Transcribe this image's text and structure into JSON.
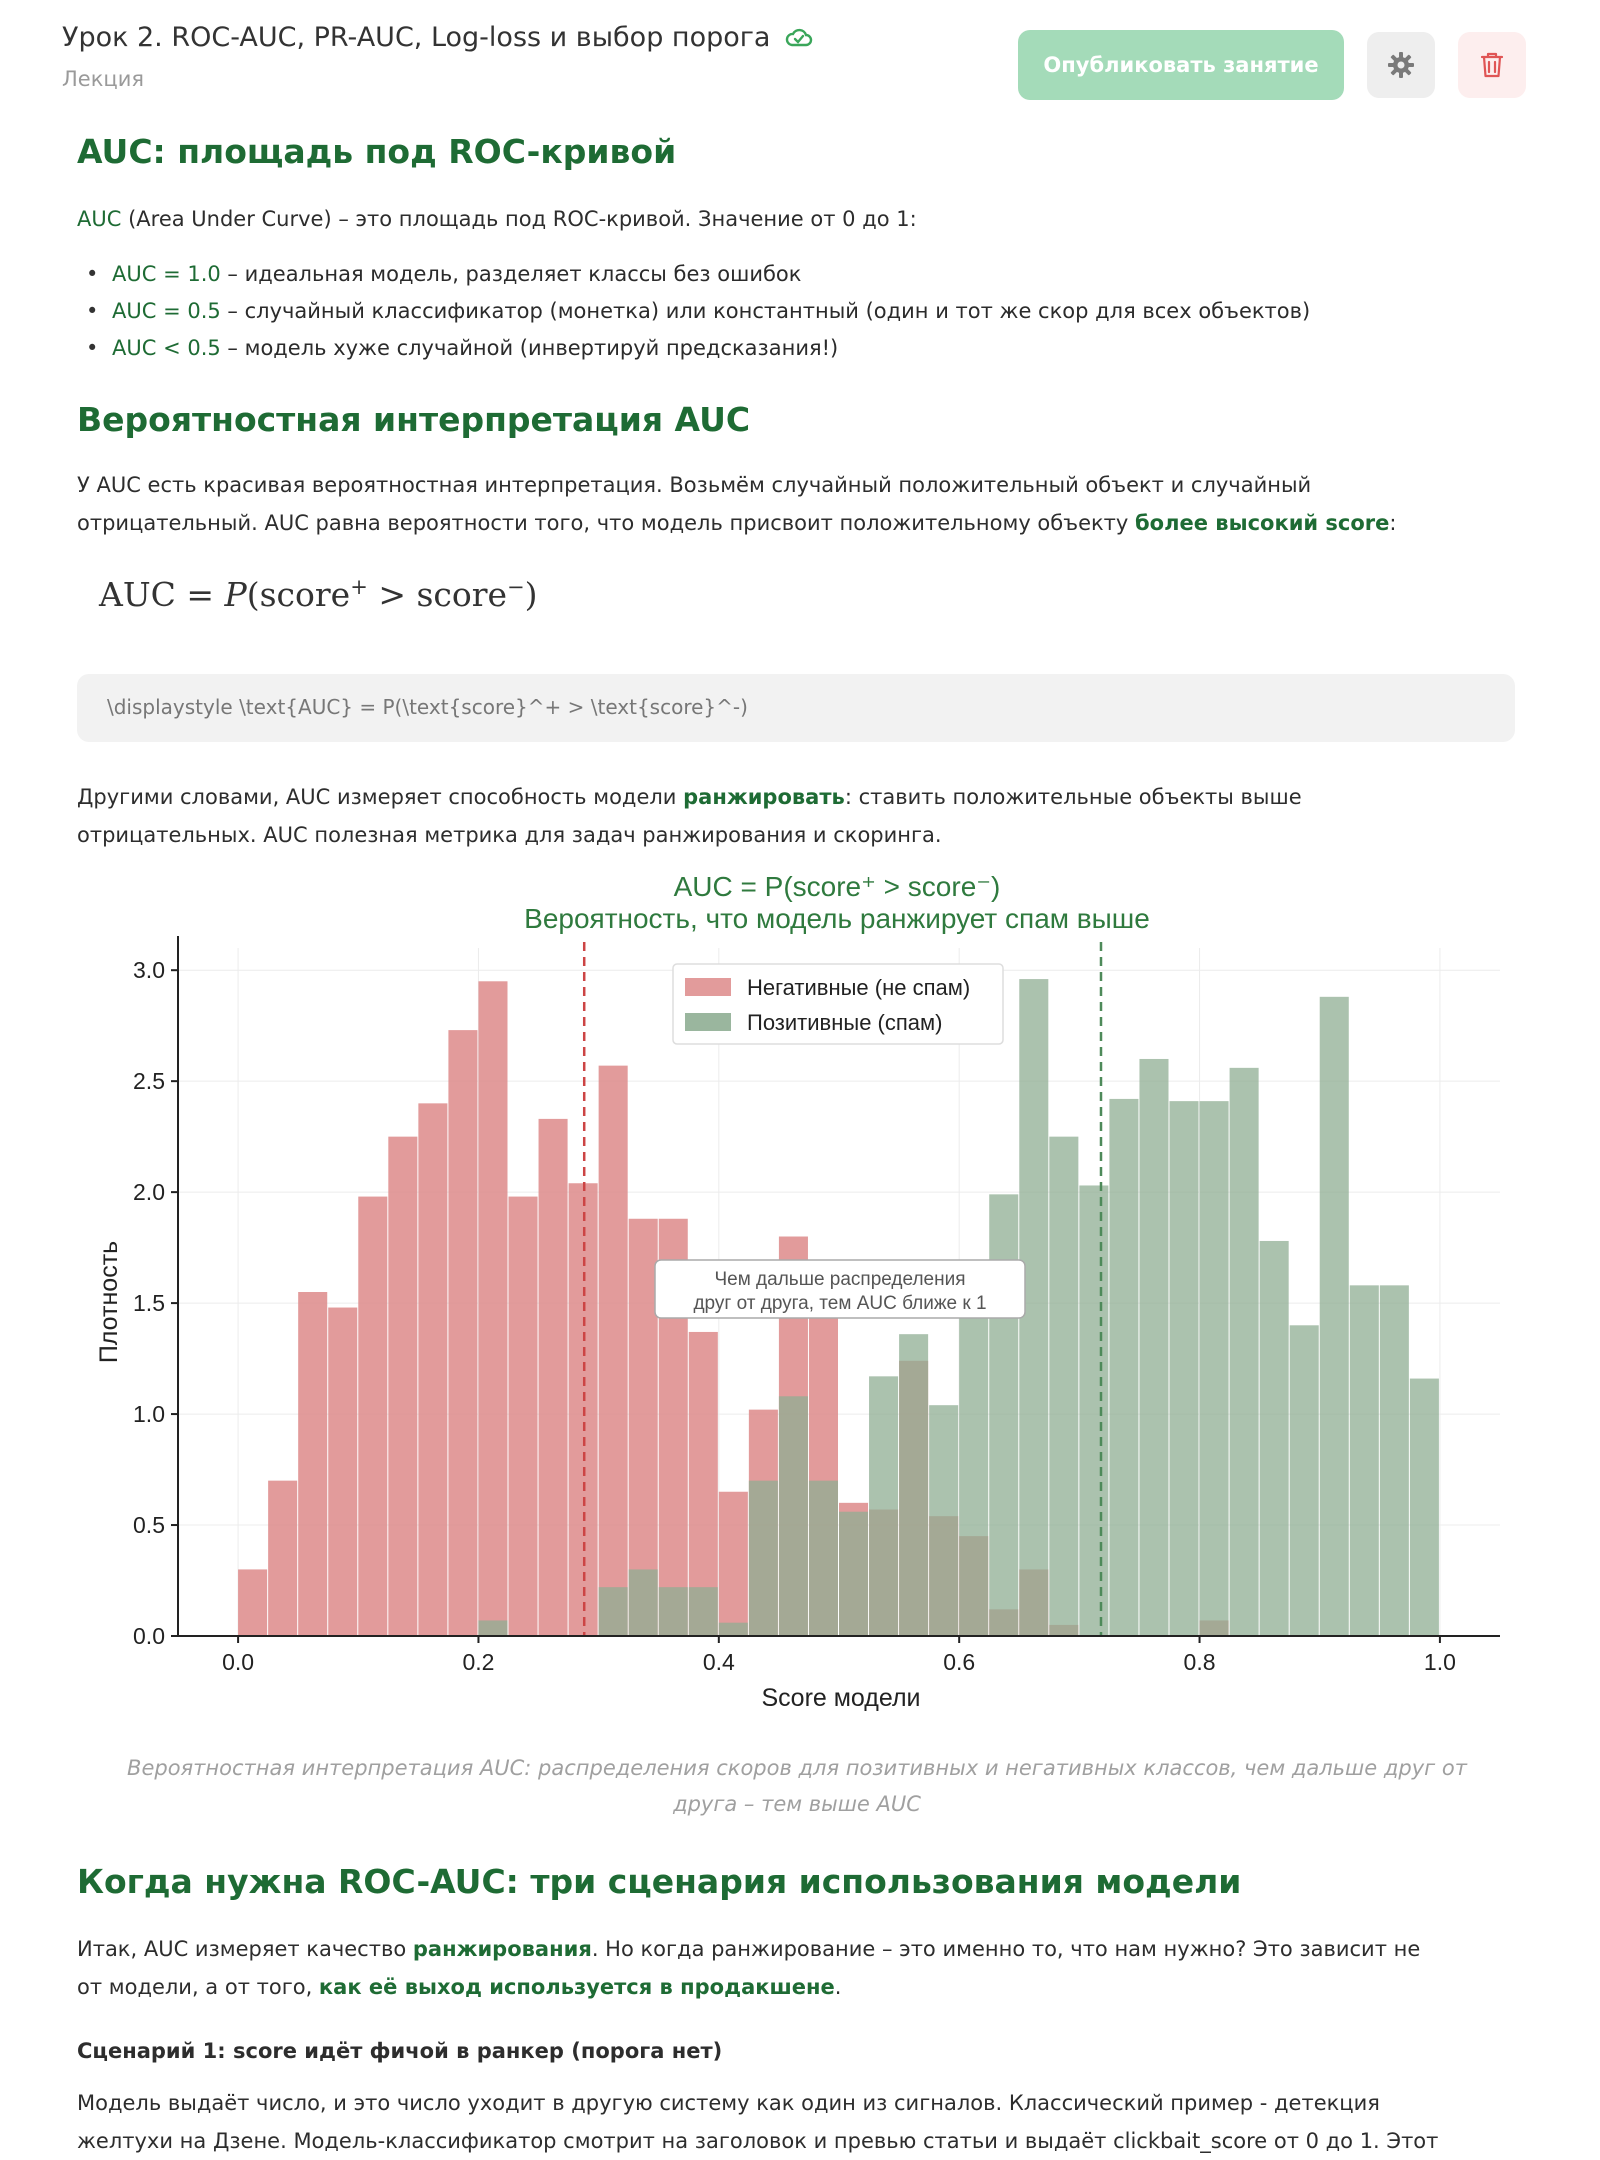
{
  "header": {
    "title": "Урок 2. ROC-AUC, PR-AUC, Log-loss и выбор порога",
    "subtitle": "Лекция",
    "publish_label": "Опубликовать занятие",
    "icons": [
      "cloud-check-icon",
      "gear-icon",
      "trash-icon"
    ]
  },
  "section1": {
    "heading": "AUC: площадь под ROC-кривой",
    "intro_term": "AUC",
    "intro_rest": " (Area Under Curve) – это площадь под ROC-кривой. Значение от 0 до 1:",
    "bullets": [
      {
        "term": "AUC = 1.0",
        "text": " – идеальная модель, разделяет классы без ошибок"
      },
      {
        "term": "AUC = 0.5",
        "text": " – случайный классификатор (монетка) или константный (один и тот же скор для всех объектов)"
      },
      {
        "term": "AUC < 0.5",
        "text": " – модель хуже случайной (инвертируй предсказания!)"
      }
    ]
  },
  "section2": {
    "heading": "Вероятностная интерпретация AUC",
    "para1_part1": "У AUC есть красивая вероятностная интерпретация. Возьмём случайный положительный объект и случайный",
    "para1_part2": "отрицательный. AUC равна вероятности того, что модель присвоит положительному объекту ",
    "para1_highlight": "более высокий score",
    "para1_end": ":",
    "formula_lhs": "AUC = ",
    "formula_p": "P",
    "formula_open": "(score",
    "formula_sup_plus": "+",
    "formula_mid": " > score",
    "formula_sup_minus": "−",
    "formula_close": ")",
    "latex": "\\displaystyle \\text{AUC} = P(\\text{score}^+ > \\text{score}^-)",
    "para2_part1": "Другими словами, AUC измеряет способность модели ",
    "para2_highlight": "ранжировать",
    "para2_part2": ": ставить положительные объекты выше",
    "para2_line2": "отрицательных. AUC полезная метрика для задач ранжирования и скоринга."
  },
  "chart_data": {
    "type": "bar",
    "title": "AUC = P(score⁺ > score⁻)",
    "subtitle": "Вероятность, что модель ранжирует спам выше",
    "xlabel": "Score модели",
    "ylabel": "Плотность",
    "xlim": [
      -0.05,
      1.05
    ],
    "ylim": [
      0,
      3.1
    ],
    "xticks": [
      "0.0",
      "0.2",
      "0.4",
      "0.6",
      "0.8",
      "1.0"
    ],
    "yticks": [
      "0.0",
      "0.5",
      "1.0",
      "1.5",
      "2.0",
      "2.5",
      "3.0"
    ],
    "bin_width": 0.025,
    "bin_starts": [
      0.0,
      0.025,
      0.05,
      0.075,
      0.1,
      0.125,
      0.15,
      0.175,
      0.2,
      0.225,
      0.25,
      0.275,
      0.3,
      0.325,
      0.35,
      0.375,
      0.4,
      0.425,
      0.45,
      0.475,
      0.5,
      0.525,
      0.55,
      0.575,
      0.6,
      0.625,
      0.65,
      0.675,
      0.7,
      0.725,
      0.75,
      0.775,
      0.8,
      0.825,
      0.85,
      0.875,
      0.9,
      0.925,
      0.95,
      0.975
    ],
    "series": [
      {
        "name": "Негативные (не спам)",
        "color": "#dd8a8a",
        "values": [
          0.3,
          0.7,
          1.55,
          1.48,
          1.98,
          2.25,
          2.4,
          2.73,
          2.95,
          1.98,
          2.33,
          2.04,
          2.57,
          1.88,
          1.88,
          1.37,
          0.65,
          1.02,
          1.8,
          1.62,
          0.6,
          0.57,
          1.24,
          0.54,
          0.45,
          0.12,
          0.3,
          0.05,
          0,
          0,
          0,
          0,
          0.07,
          0,
          0,
          0,
          0,
          0,
          0,
          0
        ]
      },
      {
        "name": "Позитивные (спам)",
        "color": "#8fae93",
        "values": [
          0,
          0,
          0,
          0,
          0,
          0,
          0,
          0,
          0.07,
          0,
          0,
          0,
          0.22,
          0.3,
          0.22,
          0.22,
          0.06,
          0.7,
          1.08,
          0.7,
          0.56,
          1.17,
          1.36,
          1.04,
          1.48,
          1.99,
          2.96,
          2.25,
          2.03,
          2.42,
          2.6,
          2.41,
          2.41,
          2.56,
          1.78,
          1.4,
          2.88,
          1.58,
          1.58,
          1.16
        ]
      }
    ],
    "vlines": [
      {
        "x": 0.288,
        "color": "#cc4444",
        "style": "dashed"
      },
      {
        "x": 0.718,
        "color": "#4e8a5a",
        "style": "dashed"
      }
    ],
    "annotation": {
      "line1": "Чем дальше распределения",
      "line2": "друг от друга, тем AUC ближе к 1"
    },
    "legend_position": "top-center",
    "grid": true
  },
  "caption": {
    "line1": "Вероятностная интерпретация AUC: распределения скоров для позитивных и негативных классов, чем дальше друг от",
    "line2": "друга – тем выше AUC"
  },
  "section3": {
    "heading": "Когда нужна ROC-AUC: три сценария использования модели",
    "p1_part1": "Итак, AUC измеряет качество ",
    "p1_highlight1": "ранжирования",
    "p1_part2": ". Но когда ранжирование – это именно то, что нам нужно? Это зависит не",
    "p1_line2_part1": "от модели, а от того, ",
    "p1_highlight2": "как её выход используется в продакшене",
    "p1_line2_end": ".",
    "scenario1": "Сценарий 1: score идёт фичой в ранкер (порога нет)",
    "p2_line1": "Модель выдаёт число, и это число уходит в другую систему как один из сигналов. Классический пример - детекция",
    "p2_line2": "желтухи на Дзене. Модель-классификатор смотрит на заголовок и превью статьи и выдаёт clickbait_score от 0 до 1. Этот"
  }
}
